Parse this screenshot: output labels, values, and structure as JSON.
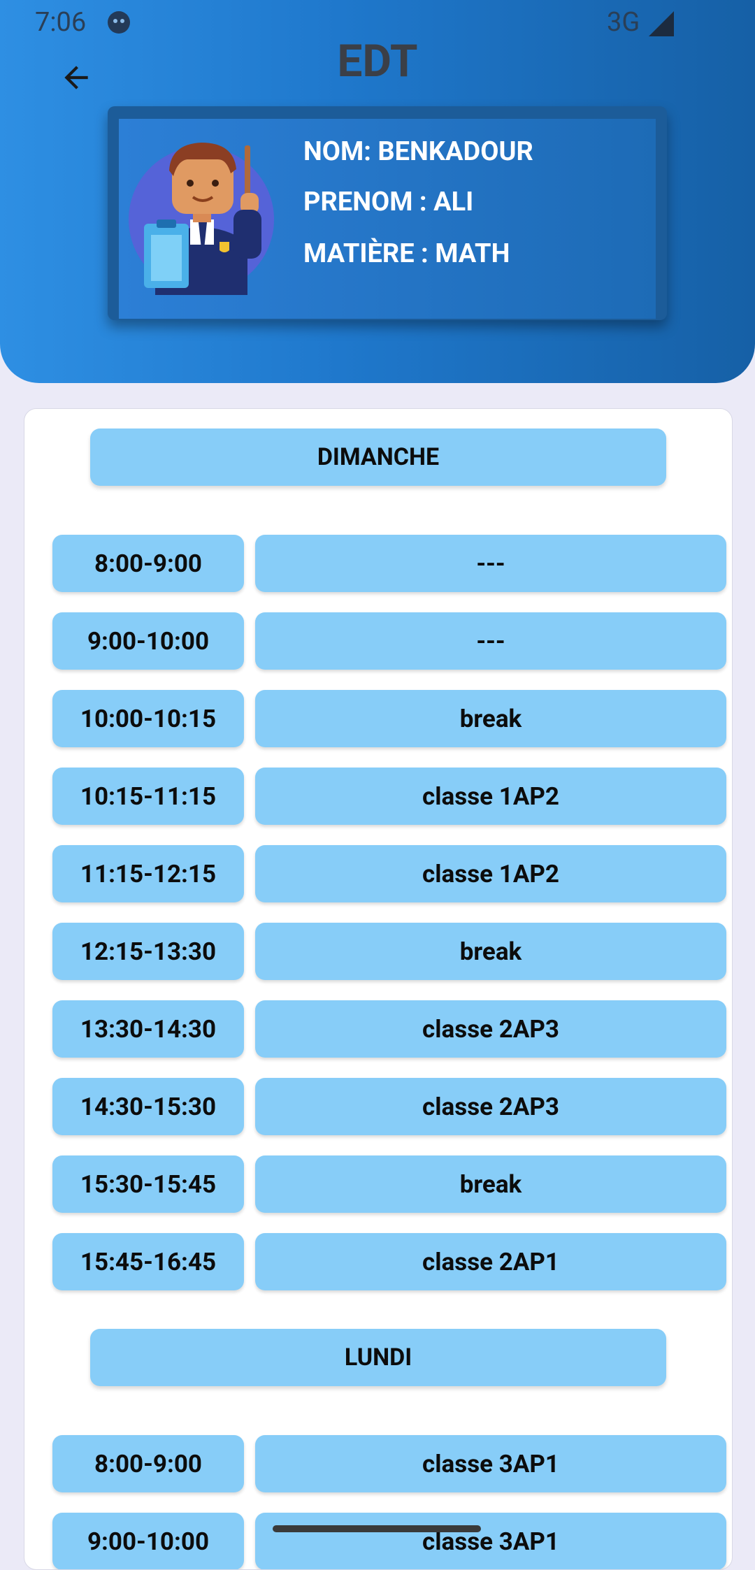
{
  "status_bar": {
    "time": "7:06",
    "network": "3G"
  },
  "header": {
    "title": "EDT",
    "profile": {
      "nom": "NOM: BENKADOUR",
      "prenom": "PRENOM : ALI",
      "matiere": "MATIÈRE : MATH"
    }
  },
  "colors": {
    "header_start": "#2e8fe3",
    "header_end": "#1660a6",
    "cell_bg": "#87cdf8",
    "page_bg": "#ebeaf7"
  },
  "schedule": {
    "dimanche": {
      "label": "DIMANCHE",
      "slots": [
        {
          "time": "8:00-9:00",
          "class": "---"
        },
        {
          "time": "9:00-10:00",
          "class": "---"
        },
        {
          "time": "10:00-10:15",
          "class": "break"
        },
        {
          "time": "10:15-11:15",
          "class": "classe 1AP2"
        },
        {
          "time": "11:15-12:15",
          "class": "classe 1AP2"
        },
        {
          "time": "12:15-13:30",
          "class": "break"
        },
        {
          "time": "13:30-14:30",
          "class": "classe 2AP3"
        },
        {
          "time": "14:30-15:30",
          "class": "classe 2AP3"
        },
        {
          "time": "15:30-15:45",
          "class": "break"
        },
        {
          "time": "15:45-16:45",
          "class": "classe 2AP1"
        }
      ]
    },
    "lundi": {
      "label": "LUNDI",
      "slots": [
        {
          "time": "8:00-9:00",
          "class": "classe 3AP1"
        },
        {
          "time": "9:00-10:00",
          "class": "classe 3AP1"
        }
      ]
    }
  },
  "icons": {
    "back": "arrow-left-icon",
    "avatar": "teacher-avatar"
  }
}
